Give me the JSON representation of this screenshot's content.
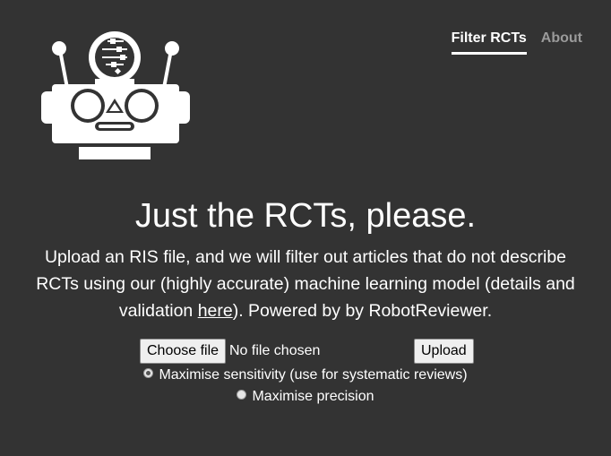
{
  "nav": {
    "items": [
      {
        "label": "Filter RCTs",
        "active": true
      },
      {
        "label": "About",
        "active": false
      }
    ]
  },
  "logo": {
    "icon": "robot-logo-icon"
  },
  "hero": {
    "title": "Just the RCTs, please.",
    "text_before_link": "Upload an RIS file, and we will filter out articles that do not describe RCTs using our (highly accurate) machine learning model (details and validation ",
    "link_text": "here",
    "text_after_link": "). Powered by by RobotReviewer."
  },
  "form": {
    "choose_label": "Choose file",
    "file_status": "No file chosen",
    "upload_label": "Upload",
    "options": [
      {
        "label": "Maximise sensitivity (use for systematic reviews)",
        "checked": true
      },
      {
        "label": "Maximise precision",
        "checked": false
      }
    ]
  },
  "colors": {
    "background": "#333333",
    "text": "#ffffff",
    "nav_inactive": "#9a9a9a"
  }
}
